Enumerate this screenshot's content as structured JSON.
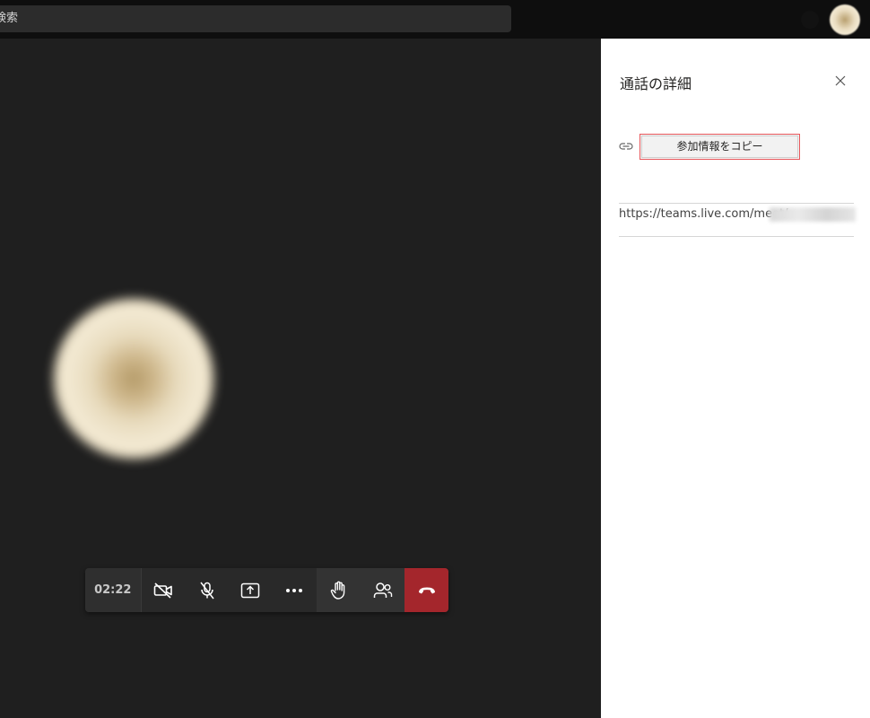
{
  "topbar": {
    "search_label": "検索"
  },
  "call": {
    "timer": "02:22",
    "controls": [
      {
        "name": "camera-off-icon"
      },
      {
        "name": "mic-off-icon"
      },
      {
        "name": "share-screen-icon"
      },
      {
        "name": "more-options-icon"
      },
      {
        "name": "raise-hand-icon"
      },
      {
        "name": "participants-icon"
      },
      {
        "name": "hang-up-icon"
      }
    ],
    "hangup_color": "#a4262c"
  },
  "details_panel": {
    "title": "通話の詳細",
    "copy_button_label": "参加情報をコピー",
    "meeting_url": "https://teams.live.com/meet/"
  },
  "colors": {
    "accent_border": "#e8585c",
    "panel_bg": "#ffffff",
    "stage_bg": "#1f1f1f"
  }
}
